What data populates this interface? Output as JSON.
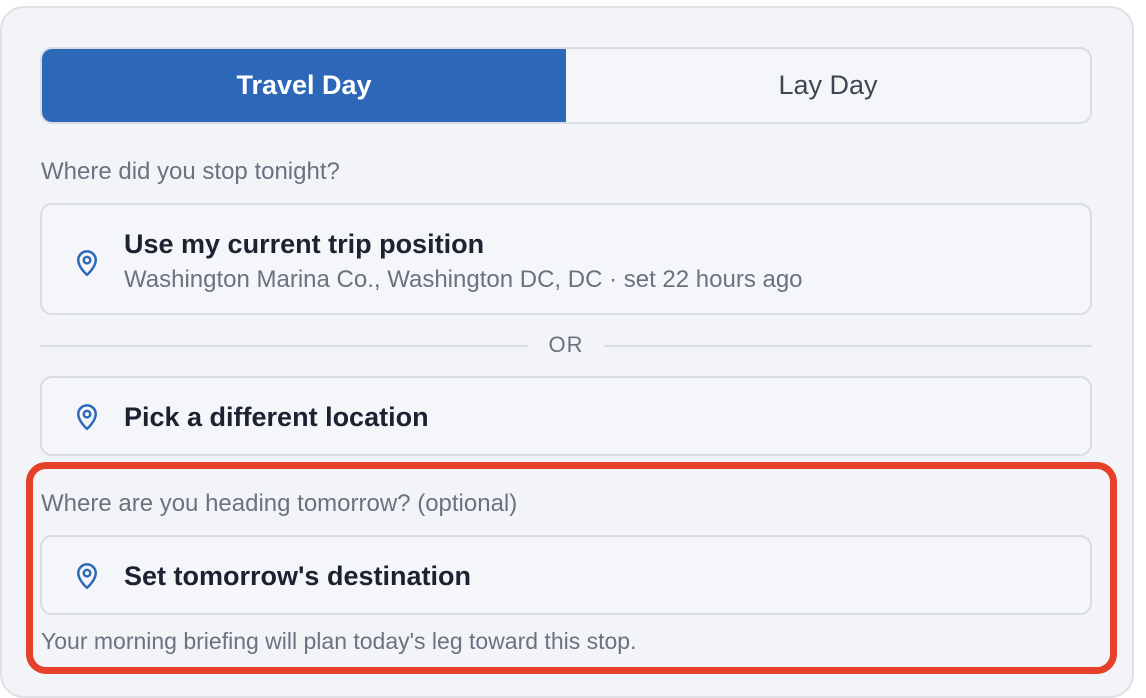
{
  "mode_toggle": {
    "travel_day_label": "Travel Day",
    "lay_day_label": "Lay Day",
    "selected": "Travel Day"
  },
  "stop_section": {
    "question": "Where did you stop tonight?",
    "current_position": {
      "title": "Use my current trip position",
      "subtitle": "Washington Marina Co., Washington DC, DC · set 22 hours ago",
      "icon": "map-pin-icon"
    },
    "or_label": "OR",
    "pick_location": {
      "title": "Pick a different location",
      "icon": "map-pin-icon"
    }
  },
  "destination_section": {
    "question": "Where are you heading tomorrow?",
    "optional_label": "(optional)",
    "set_destination": {
      "title": "Set tomorrow's destination",
      "icon": "map-pin-icon"
    },
    "hint": "Your morning briefing will plan today's leg toward this stop."
  },
  "colors": {
    "accent": "#2d68b8",
    "highlight": "#e5412a",
    "panel_bg": "#f3f4f8"
  }
}
